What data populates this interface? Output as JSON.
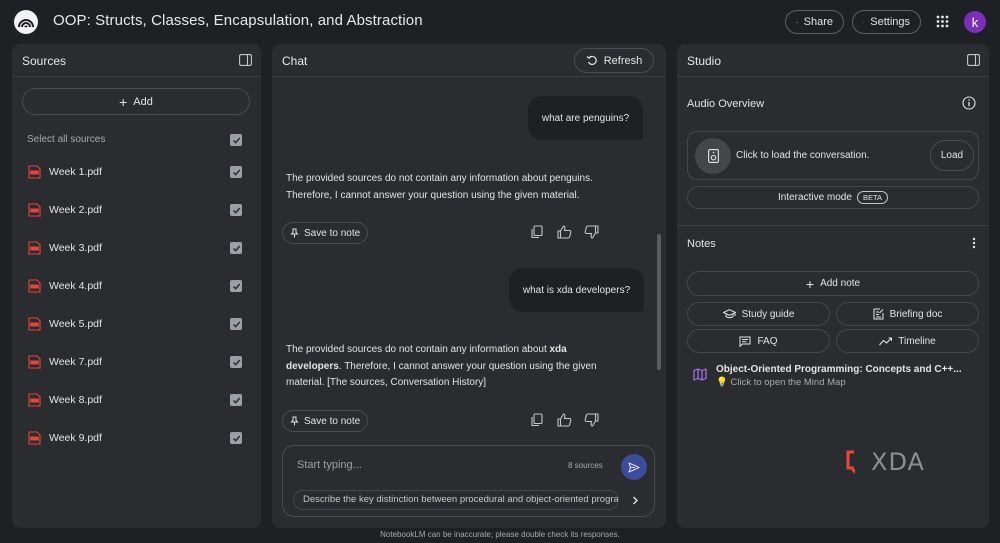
{
  "app": {
    "title": "OOP: Structs, Classes, Encapsulation, and Abstraction",
    "share_label": "Share",
    "settings_label": "Settings",
    "avatar_initial": "k"
  },
  "sources": {
    "title": "Sources",
    "add_label": "Add",
    "select_all_label": "Select all sources",
    "items": [
      {
        "name": "Week 1.pdf",
        "checked": true
      },
      {
        "name": "Week 2.pdf",
        "checked": true
      },
      {
        "name": "Week 3.pdf",
        "checked": true
      },
      {
        "name": "Week 4.pdf",
        "checked": true
      },
      {
        "name": "Week 5.pdf",
        "checked": true
      },
      {
        "name": "Week 7.pdf",
        "checked": true
      },
      {
        "name": "Week 8.pdf",
        "checked": true
      },
      {
        "name": "Week 9.pdf",
        "checked": true
      }
    ]
  },
  "chat": {
    "title": "Chat",
    "refresh_label": "Refresh",
    "messages": [
      {
        "role": "user",
        "text": "what are penguins?"
      },
      {
        "role": "assistant",
        "text": "The provided sources do not contain any information about penguins. Therefore, I cannot answer your question using the given material.",
        "save_label": "Save to note"
      },
      {
        "role": "user",
        "text": "what is xda developers?"
      },
      {
        "role": "assistant",
        "text_before": "The provided sources do not contain any information about ",
        "text_bold": "xda developers",
        "text_after": ". Therefore, I cannot answer your question using the given material. [The sources, Conversation History]",
        "save_label": "Save to note"
      }
    ],
    "composer": {
      "placeholder": "Start typing...",
      "source_count": "8 sources",
      "suggestion": "Describe the key distinction between procedural and object-oriented programming."
    }
  },
  "studio": {
    "title": "Studio",
    "audio_overview": {
      "title": "Audio Overview",
      "prompt": "Click to load the conversation.",
      "load_label": "Load",
      "interactive_label": "Interactive mode",
      "beta_label": "BETA"
    },
    "notes": {
      "title": "Notes",
      "add_note_label": "Add note",
      "buttons": {
        "study_guide": "Study guide",
        "briefing_doc": "Briefing doc",
        "faq": "FAQ",
        "timeline": "Timeline"
      },
      "mindmap_title": "Object-Oriented Programming: Concepts and C++...",
      "mindmap_subtitle": "Click to open the Mind Map"
    }
  },
  "watermark": "XDA",
  "footer": "NotebookLM can be inaccurate; please double check its responses.",
  "colors": {
    "background": "#1f2023",
    "panel": "#2b2c2f",
    "pdf_red": "#e8453c",
    "avatar": "#7b2fb8",
    "send": "#3c4b9a",
    "mindmap": "#a374f5"
  }
}
